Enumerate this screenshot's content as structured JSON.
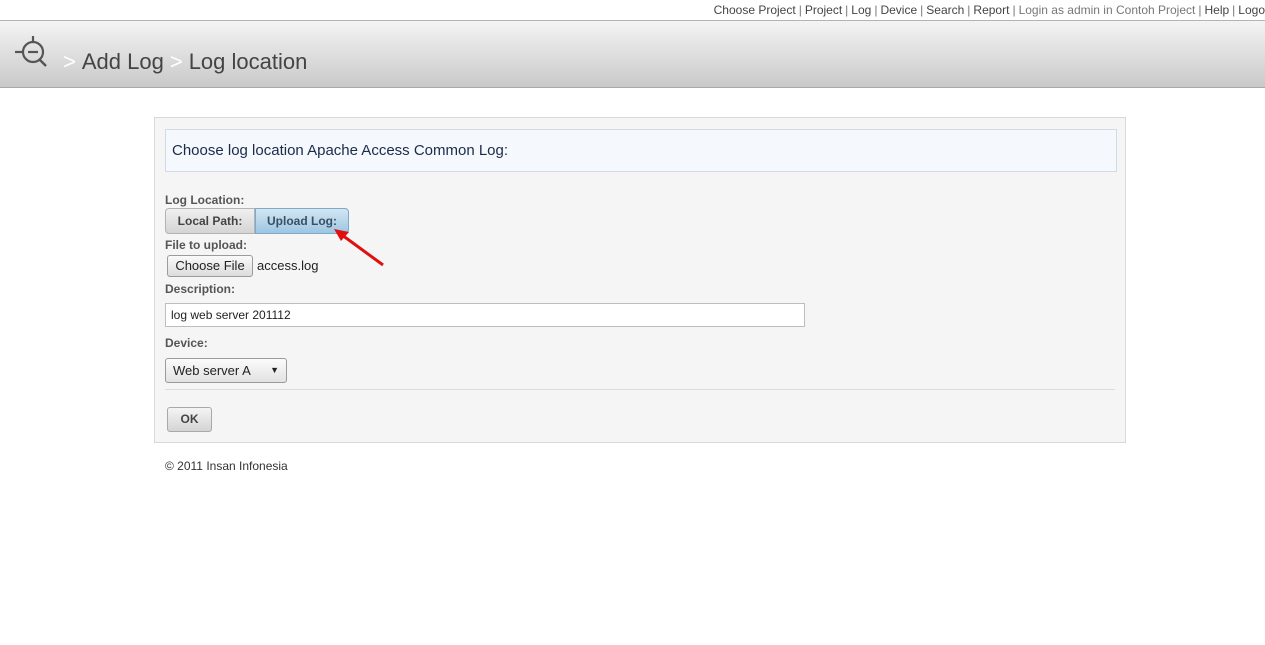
{
  "topnav": {
    "items": [
      "Choose Project",
      "Project",
      "Log",
      "Device",
      "Search",
      "Report"
    ],
    "login_text": "Login as admin in Contoh Project",
    "help": "Help",
    "logout": "Logo"
  },
  "header": {
    "breadcrumb": [
      "Add Log",
      "Log location"
    ],
    "separator": ">"
  },
  "form": {
    "info_text": "Choose log location Apache Access Common Log:",
    "log_location_label": "Log Location:",
    "local_path_label": "Local Path:",
    "upload_log_label": "Upload Log:",
    "file_label": "File to upload:",
    "choose_file_label": "Choose File",
    "file_name": "access.log",
    "description_label": "Description:",
    "description_value": "log web server 201112",
    "device_label": "Device:",
    "device_selected": "Web server A",
    "ok_label": "OK"
  },
  "footer": {
    "copyright": "© 2011 Insan Infonesia"
  },
  "colors": {
    "selected_segment": "#9dc6e2",
    "annotation_arrow": "#e01010"
  },
  "icons": {
    "logo": "magnifier-target-logo-icon",
    "arrow": "red-annotation-arrow-icon"
  }
}
